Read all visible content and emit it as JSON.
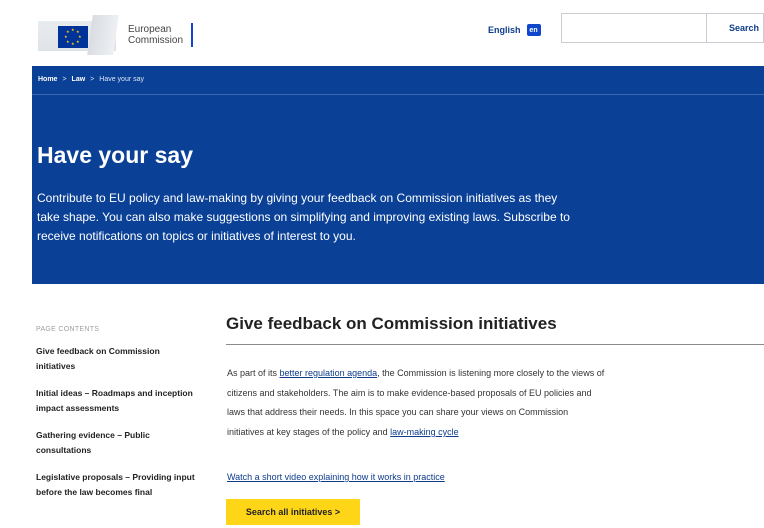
{
  "header": {
    "logo_line1": "European",
    "logo_line2": "Commission",
    "language": "English",
    "language_code": "en",
    "search_placeholder": "",
    "search_button": "Search"
  },
  "breadcrumb": {
    "items": [
      "Home",
      "Law",
      "Have your say"
    ],
    "separator": ">"
  },
  "hero": {
    "title": "Have your say",
    "description": "Contribute to EU policy and law-making by giving your feedback on Commission initiatives as they take shape. You can also make suggestions on simplifying and improving existing laws. Subscribe to receive notifications on topics or initiatives of interest to you."
  },
  "sidebar": {
    "heading": "PAGE CONTENTS",
    "items": [
      "Give feedback on Commission initiatives",
      "Initial ideas – Roadmaps and inception impact assessments",
      "Gathering evidence – Public consultations",
      "Legislative proposals – Providing input before the law becomes final"
    ]
  },
  "main": {
    "title": "Give feedback on Commission initiatives",
    "body_part1": "As part of its ",
    "body_link1": "better regulation agenda",
    "body_part2": ", the Commission is listening more closely to the views of citizens and stakeholders. The aim is to make evidence-based proposals of EU policies and laws that address their needs. In this space you can share your views on Commission initiatives at key stages of the policy and ",
    "body_link2": "law-making cycle",
    "body_part3": "",
    "video_link": "Watch a short video explaining how it works in practice",
    "cta": "Search all initiatives >"
  },
  "colors": {
    "hero_bg": "#0a4197",
    "cta_bg": "#ffd617",
    "link": "#0e3c8a"
  }
}
